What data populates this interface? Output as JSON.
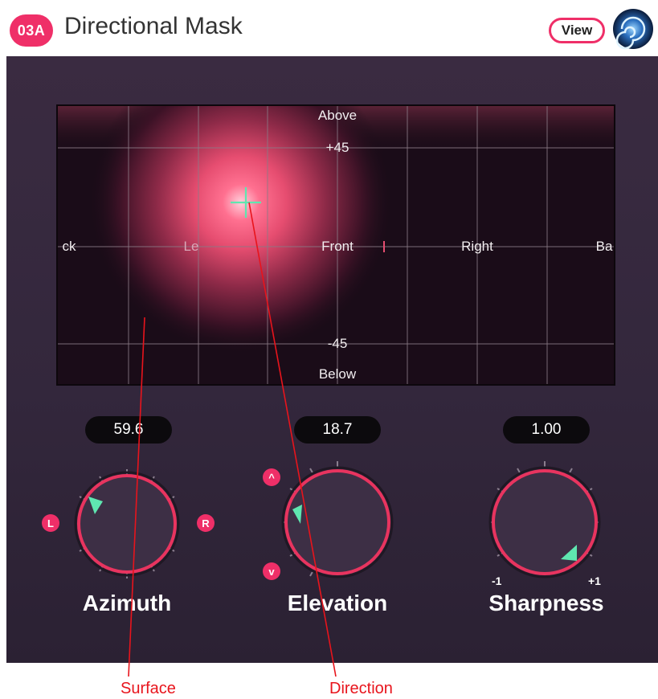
{
  "header": {
    "badge": "03A",
    "title": "Directional Mask",
    "view_button": "View",
    "logo_icon": "spiral-logo-icon"
  },
  "display": {
    "labels": {
      "above": "Above",
      "plus45": "+45",
      "minus45": "-45",
      "below": "Below",
      "back_left": "ck",
      "left": "Le",
      "front": "Front",
      "right": "Right",
      "back_right": "Ba"
    },
    "direction_marker_icon": "crosshair-icon"
  },
  "controls": {
    "azimuth": {
      "label": "Azimuth",
      "value": "59.6",
      "left_badge": "L",
      "right_badge": "R"
    },
    "elevation": {
      "label": "Elevation",
      "value": "18.7",
      "up_badge": "^",
      "down_badge": "v"
    },
    "sharpness": {
      "label": "Sharpness",
      "value": "1.00",
      "min_label": "-1",
      "max_label": "+1"
    }
  },
  "callouts": {
    "surface": "Surface",
    "direction": "Direction"
  },
  "colors": {
    "accent": "#ef2f68",
    "panel": "#3a2b41",
    "pointer": "#5fe6b0",
    "callout": "#e8141c"
  }
}
